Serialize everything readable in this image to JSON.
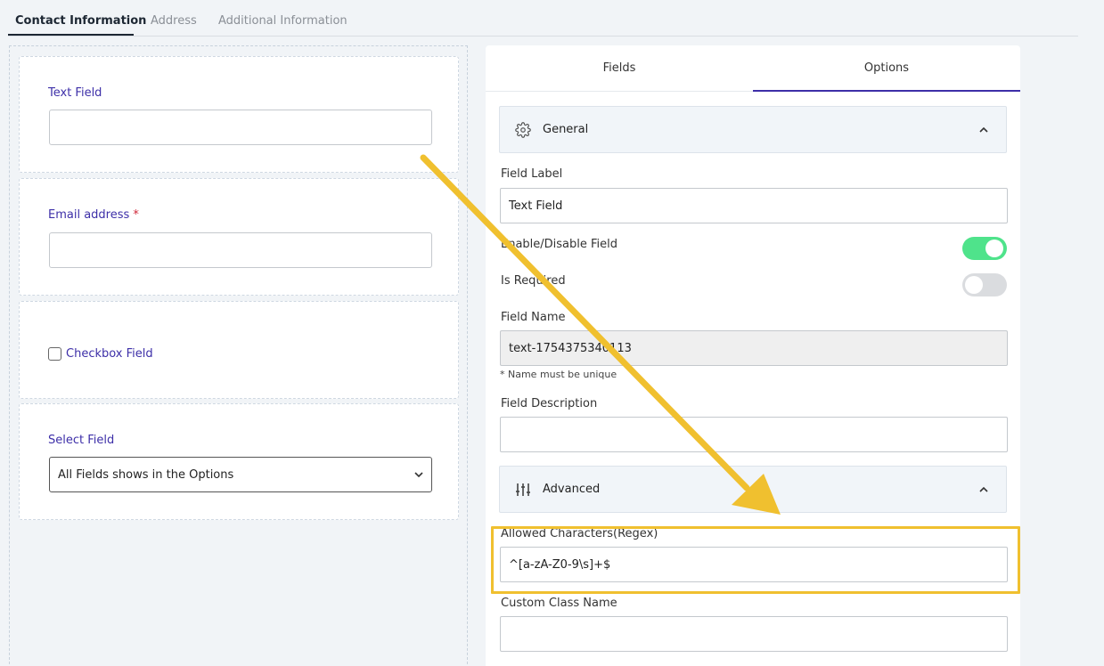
{
  "step_tabs": [
    "Contact Information",
    "Address",
    "Additional Information"
  ],
  "canvas": {
    "text_field": {
      "label": "Text Field"
    },
    "email_field": {
      "label": "Email address",
      "required_mark": "*"
    },
    "checkbox_field": {
      "label": "Checkbox Field"
    },
    "select_field": {
      "label": "Select Field",
      "selected": "All Fields shows in the Options"
    }
  },
  "panel": {
    "tabs": [
      "Fields",
      "Options"
    ],
    "active_tab": "Options",
    "general": {
      "title": "General",
      "icon": "gear-icon",
      "field_label_label": "Field Label",
      "field_label_value": "Text Field",
      "enable_label": "Enable/Disable Field",
      "enable_state": true,
      "required_label": "Is Required",
      "required_state": false,
      "field_name_label": "Field Name",
      "field_name_value": "text-1754375340113",
      "field_name_hint": "* Name must be unique",
      "description_label": "Field Description",
      "description_value": ""
    },
    "advanced": {
      "title": "Advanced",
      "icon": "sliders-icon",
      "regex_label": "Allowed Characters(Regex)",
      "regex_value": "^[a-zA-Z0-9\\s]+$",
      "class_label": "Custom Class Name",
      "class_value": ""
    }
  },
  "colors": {
    "accent": "#3d2fa8",
    "toggle_on": "#4fe38b",
    "highlight": "#f0c02f",
    "required": "#d0283a"
  }
}
